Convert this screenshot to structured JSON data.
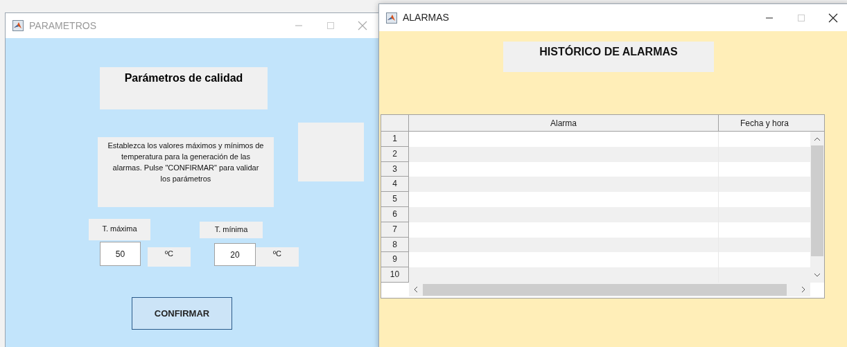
{
  "windows": [
    {
      "kind": "parametros",
      "title": "PARAMETROS",
      "active": false,
      "heading": "Parámetros de calidad",
      "description": "Establezca los valores máximos y mínimos de temperatura para la generación de las alarmas. Pulse \"CONFIRMAR\" para validar los parámetros",
      "fields": [
        {
          "label": "T. máxima",
          "value": "50",
          "unit": "ºC"
        },
        {
          "label": "T. mínima",
          "value": "20",
          "unit": "ºC"
        }
      ],
      "button": "CONFIRMAR"
    },
    {
      "kind": "alarmas",
      "title": "ALARMAS",
      "active": true,
      "heading": "HISTÓRICO DE ALARMAS",
      "table": {
        "columns": [
          "Alarma",
          "Fecha y hora"
        ],
        "rows": [
          "1",
          "2",
          "3",
          "4",
          "5",
          "6",
          "7",
          "8",
          "9",
          "10"
        ]
      }
    }
  ]
}
